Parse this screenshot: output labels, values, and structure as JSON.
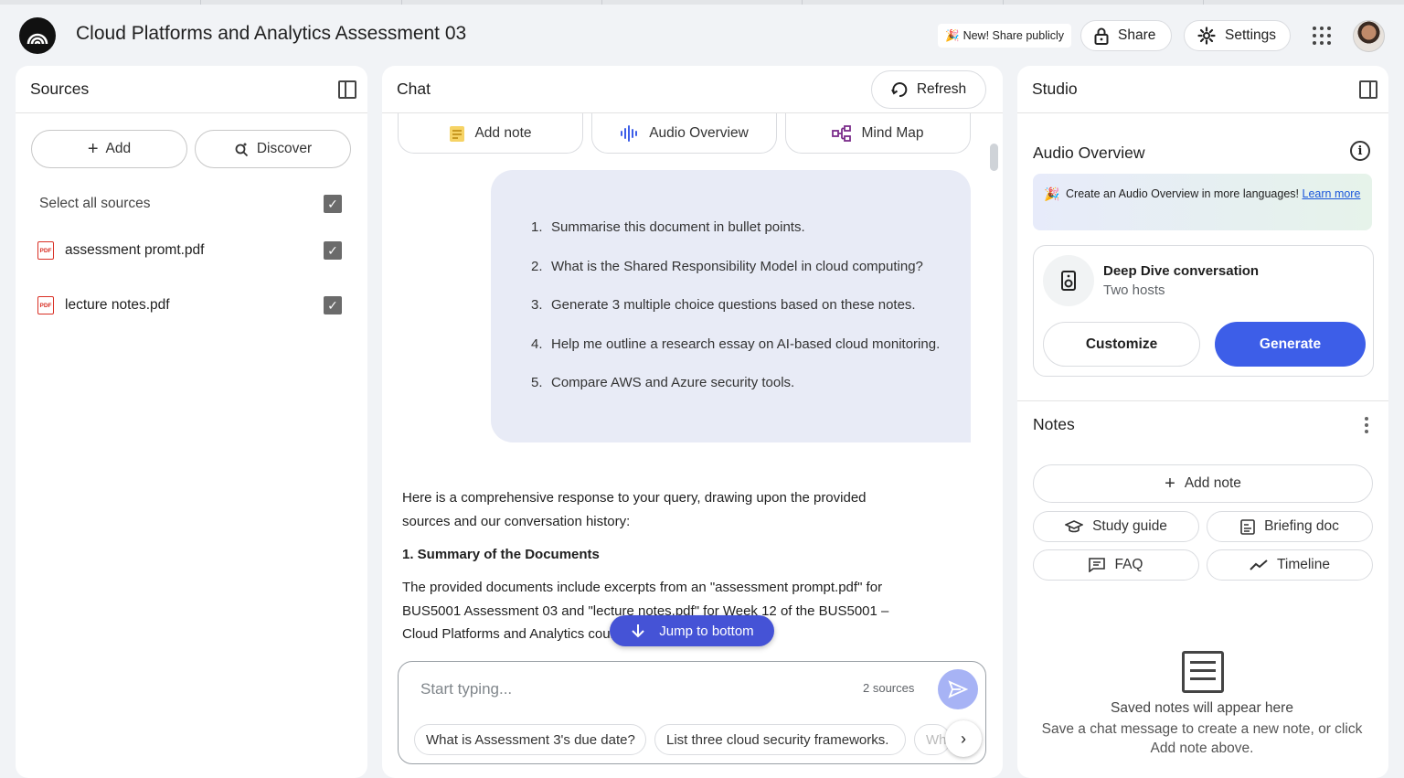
{
  "header": {
    "title": "Cloud Platforms and Analytics Assessment 03",
    "share_publicly": "New! Share publicly",
    "share_label": "Share",
    "settings_label": "Settings"
  },
  "sources": {
    "title": "Sources",
    "add_label": "Add",
    "discover_label": "Discover",
    "select_all_label": "Select all sources",
    "items": [
      {
        "name": "assessment promt.pdf",
        "icon": "pdf-icon",
        "checked": true
      },
      {
        "name": "lecture notes.pdf",
        "icon": "pdf-icon",
        "checked": true
      }
    ]
  },
  "chat": {
    "title": "Chat",
    "refresh_label": "Refresh",
    "tools": [
      "Add note",
      "Audio Overview",
      "Mind Map"
    ],
    "user_message": [
      {
        "num": "1.",
        "text": "Summarise this document in bullet points."
      },
      {
        "num": "2.",
        "text": "What is the Shared Responsibility Model in cloud computing?"
      },
      {
        "num": "3.",
        "text": "Generate 3 multiple choice questions based on these notes."
      },
      {
        "num": "4.",
        "text": "Help me outline a research essay on AI-based cloud monitoring."
      },
      {
        "num": "5.",
        "text": "Compare AWS and Azure security tools."
      }
    ],
    "response": {
      "intro": "Here is a comprehensive response to your query, drawing upon the provided sources and our conversation history:",
      "heading": "1. Summary of the Documents",
      "body": "The provided documents include excerpts from an \"assessment prompt.pdf\" for BUS5001 Assessment 03 and \"lecture notes.pdf\" for Week 12 of the BUS5001 – Cloud Platforms and Analytics course"
    },
    "jump_label": "Jump to bottom",
    "input_placeholder": "Start typing...",
    "source_count": "2 sources",
    "suggestions": [
      "What is Assessment 3's due date?",
      "List three cloud security frameworks.",
      "Wh"
    ]
  },
  "studio": {
    "title": "Studio",
    "audio_overview_title": "Audio Overview",
    "promo_text": "Create an Audio Overview in more languages!",
    "promo_link": "Learn more",
    "deep_dive_title": "Deep Dive conversation",
    "deep_dive_sub": "Two hosts",
    "customize_label": "Customize",
    "generate_label": "Generate",
    "notes_title": "Notes",
    "add_note_label": "Add note",
    "note_actions": [
      "Study guide",
      "Briefing doc",
      "FAQ",
      "Timeline"
    ],
    "empty_title": "Saved notes will appear here",
    "empty_desc": "Save a chat message to create a new note, or click Add note above."
  },
  "colors": {
    "accent": "#3d5ee8",
    "jump_button": "#4553d6",
    "user_bubble": "#e8ebf6",
    "pdf_red": "#d93025"
  }
}
